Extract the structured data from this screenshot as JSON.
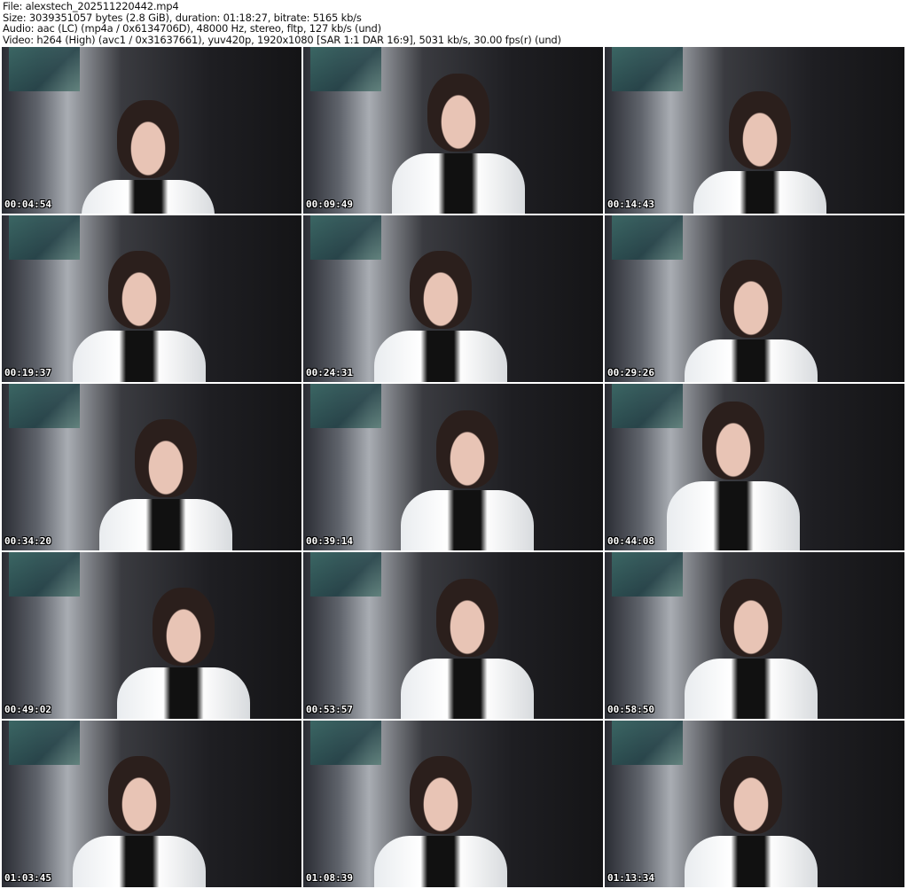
{
  "header": {
    "file": "File: alexstech_202511220442.mp4",
    "size": "Size: 3039351057 bytes (2.8 GiB), duration: 01:18:27, bitrate: 5165 kb/s",
    "audio": "Audio: aac (LC) (mp4a / 0x6134706D), 48000 Hz, stereo, fltp, 127 kb/s (und)",
    "video": "Video: h264 (High) (avc1 / 0x31637661), yuv420p, 1920x1080 [SAR 1:1 DAR 16:9], 5031 kb/s, 30.00 fps(r) (und)"
  },
  "thumbnails": [
    {
      "timestamp": "00:04:54"
    },
    {
      "timestamp": "00:09:49"
    },
    {
      "timestamp": "00:14:43"
    },
    {
      "timestamp": "00:19:37"
    },
    {
      "timestamp": "00:24:31"
    },
    {
      "timestamp": "00:29:26"
    },
    {
      "timestamp": "00:34:20"
    },
    {
      "timestamp": "00:39:14"
    },
    {
      "timestamp": "00:44:08"
    },
    {
      "timestamp": "00:49:02"
    },
    {
      "timestamp": "00:53:57"
    },
    {
      "timestamp": "00:58:50"
    },
    {
      "timestamp": "01:03:45"
    },
    {
      "timestamp": "01:08:39"
    },
    {
      "timestamp": "01:13:34"
    }
  ]
}
